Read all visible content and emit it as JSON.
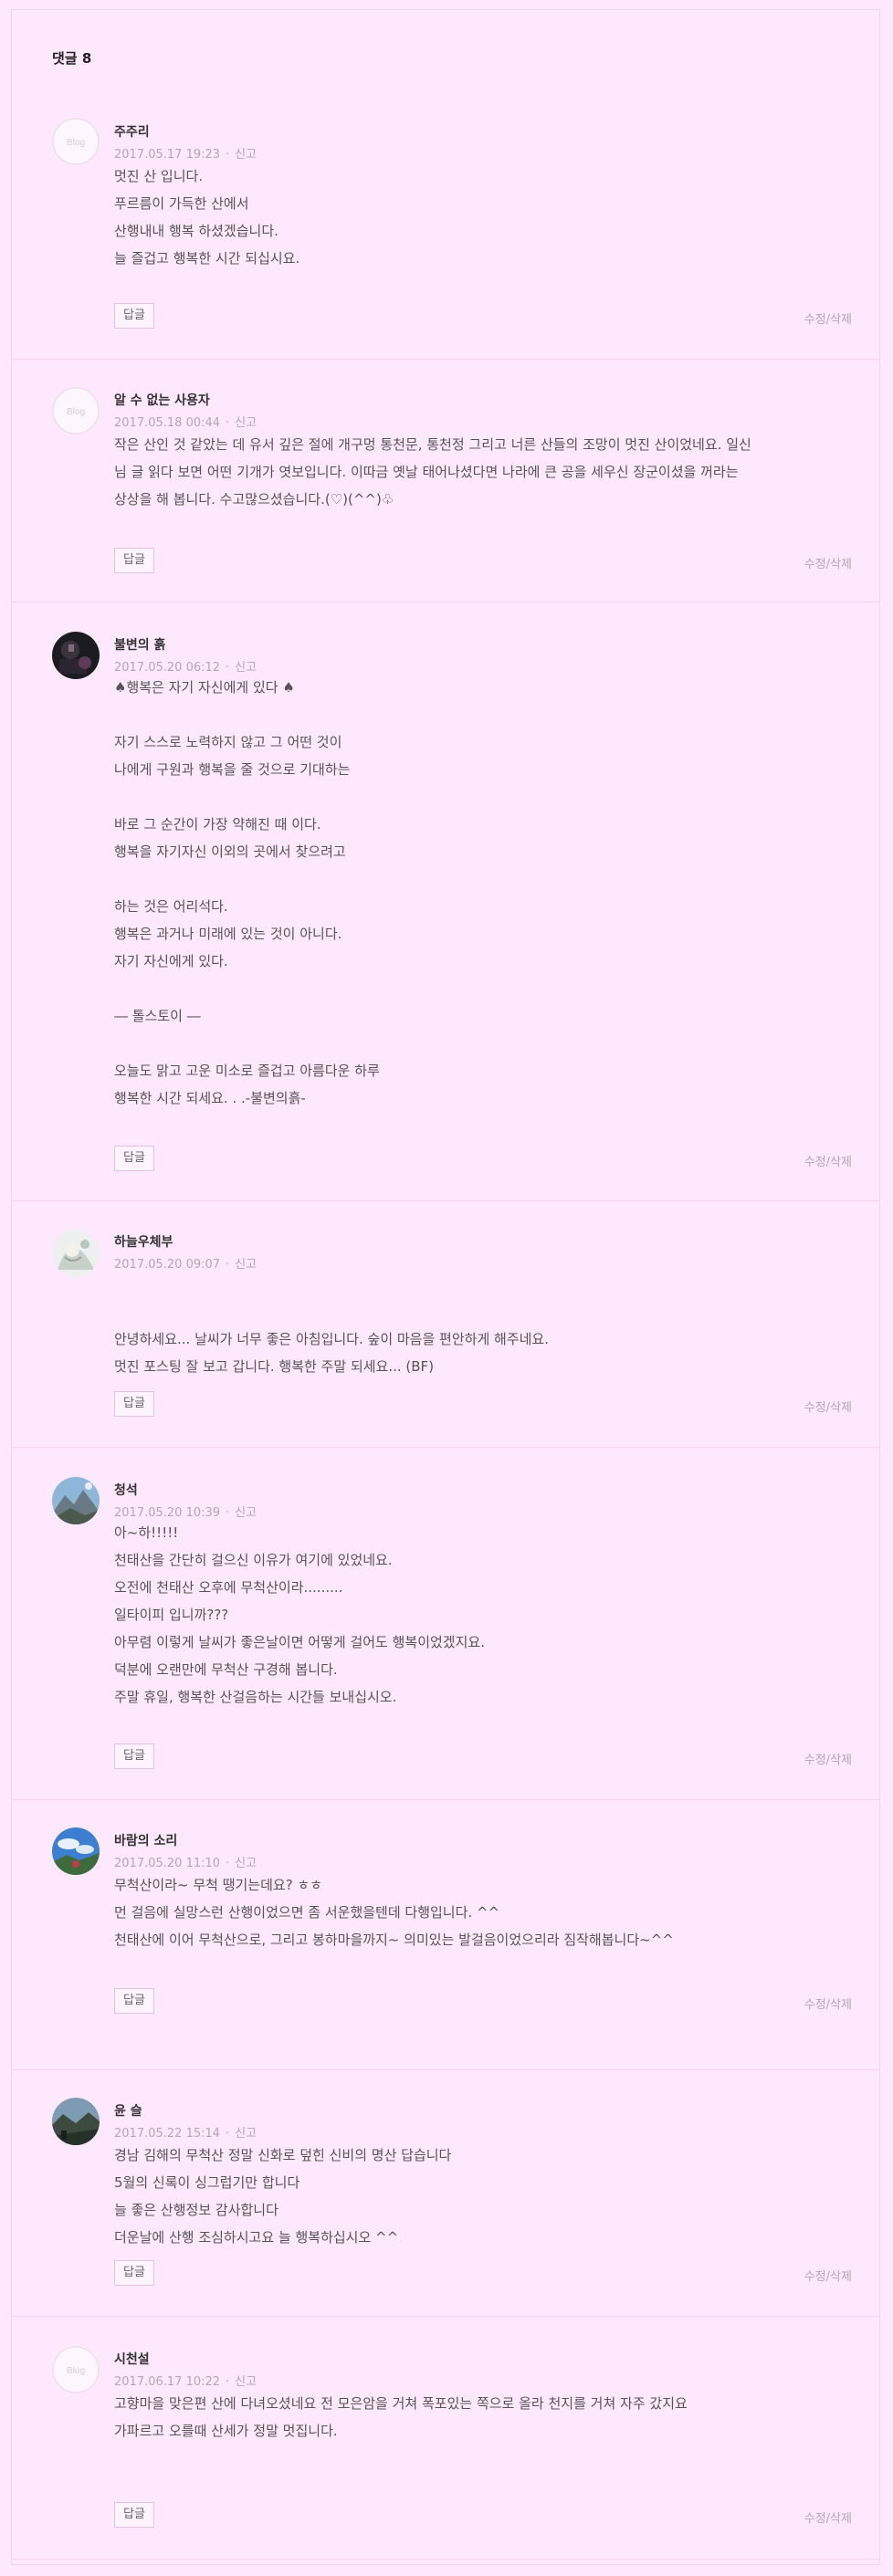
{
  "header": {
    "title": "댓글 8"
  },
  "labels": {
    "report": "신고",
    "reply": "답글",
    "edit_delete": "수정/삭제",
    "blog_placeholder": "Blog"
  },
  "comments": [
    {
      "author": "주주리",
      "date": "2017.05.17 19:23",
      "avatar": "blog-placeholder-icon",
      "body": "멋진 산 입니다.\n푸르름이 가득한 산에서\n산행내내 행복 하셨겠습니다.\n늘 즐겁고 행복한 시간 되십시요."
    },
    {
      "author": "알 수 없는 사용자",
      "date": "2017.05.18 00:44",
      "avatar": "blog-placeholder-icon",
      "body": "작은 산인 것 같았는 데 유서 깊은 절에 개구멍 통천문, 통천정 그리고 너른 산들의 조망이 멋진 산이었네요. 일신님 글 읽다 보면 어떤 기개가 엿보입니다. 이따금 옛날 태어나셨다면 나라에 큰 공을 세우신 장군이셨을 꺼라는 상상을 해 봅니다. 수고많으셨습니다.(♡)(^^)♧"
    },
    {
      "author": "불변의 흙",
      "date": "2017.05.20 06:12",
      "avatar": "dark-photo-avatar-icon",
      "body": "♠행복은 자기 자신에게 있다 ♠\n\n자기 스스로 노력하지 않고 그 어떤 것이\n나에게 구원과 행복을 줄 것으로 기대하는\n\n바로 그 순간이 가장 약해진 때 이다.\n행복을 자기자신 이외의 곳에서 찾으려고\n\n하는 것은 어리석다.\n행복은 과거나 미래에 있는 것이 아니다.\n자기 자신에게 있다.\n\n― 톨스토이 ―\n\n오늘도 맑고 고운 미소로 즐겁고 아름다운 하루\n행복한 시간 되세요. . .-불변의흙-"
    },
    {
      "author": "하늘우체부",
      "date": "2017.05.20 09:07",
      "avatar": "illustration-avatar-icon",
      "body": "\n안녕하세요... 날씨가 너무 좋은 아침입니다. 숲이 마음을 편안하게 해주네요.\n멋진 포스팅 잘 보고 갑니다. 행복한 주말 되세요... (BF)"
    },
    {
      "author": "청석",
      "date": "2017.05.20 10:39",
      "avatar": "mountain-photo-avatar-icon",
      "body": "아~하!!!!!\n천태산을 간단히 걸으신 이유가 여기에 있었네요.\n오전에 천태산 오후에 무척산이라.........\n일타이피 입니까???\n아무렴 이렇게 날씨가 좋은날이면 어떻게 걸어도 행복이었겠지요.\n덕분에 오랜만에 무척산 구경해 봅니다.\n주말 휴일, 행복한 산걸음하는 시간들 보내십시오."
    },
    {
      "author": "바람의 소리",
      "date": "2017.05.20 11:10",
      "avatar": "sky-photo-avatar-icon",
      "body": "무척산이라~ 무척 땡기는데요? ㅎㅎ\n먼 걸음에 실망스런 산행이었으면 좀 서운했을텐데 다행입니다. ^^\n천태산에 이어 무척산으로, 그리고 봉하마을까지~ 의미있는 발걸음이었으리라 짐작해봅니다~^^"
    },
    {
      "author": "윤 슬",
      "date": "2017.05.22 15:14",
      "avatar": "landscape-photo-avatar-icon",
      "body": "경남 김해의 무척산 정말 신화로 덮힌 신비의 명산 답습니다\n5월의 신록이 싱그럽기만 합니다\n늘 좋은 산행정보 감사합니다\n더운날에 산행 조심하시고요 늘 행복하십시오 ^^"
    },
    {
      "author": "시천설",
      "date": "2017.06.17 10:22",
      "avatar": "blog-placeholder-icon",
      "body": "고향마을 맞은편 산에 다녀오셨네요 전 모은암을 거쳐 폭포있는 쪽으로 올라 천지를 거쳐 자주 갔지요\n가파르고 오를때 산세가 정말 멋집니다."
    }
  ]
}
